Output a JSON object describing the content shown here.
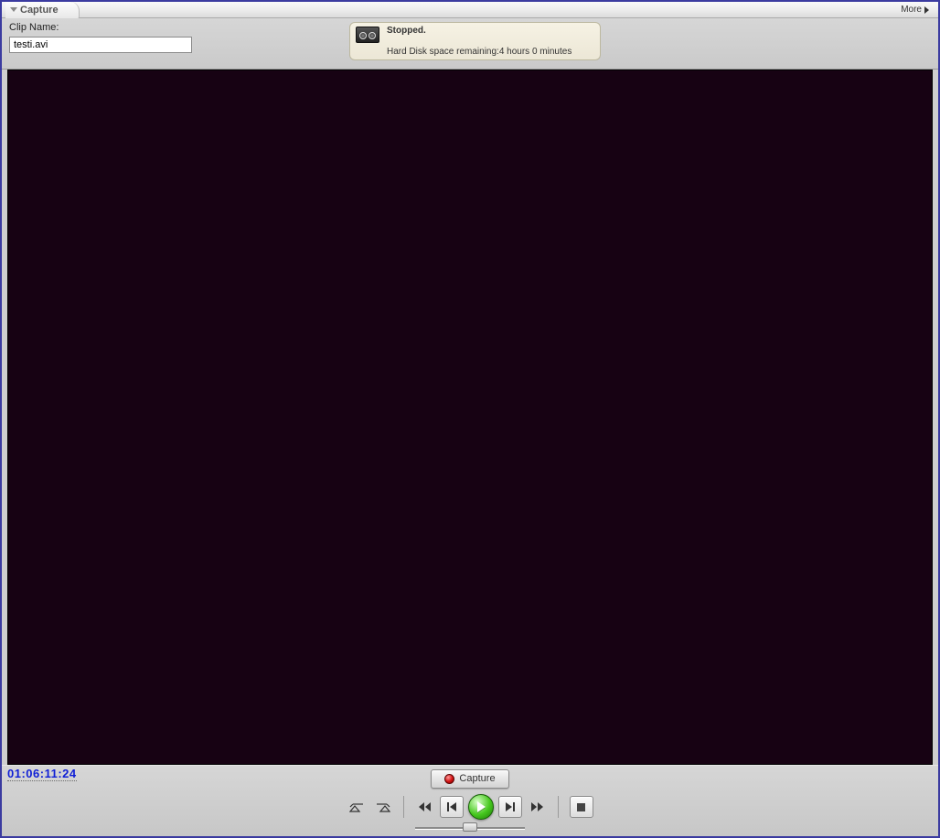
{
  "window": {
    "title": "Capture",
    "more_label": "More"
  },
  "header": {
    "clipname_label": "Clip Name:",
    "clipname_value": "testi.avi"
  },
  "status": {
    "title": "Stopped.",
    "subtitle": "Hard Disk space remaining:4 hours 0 minutes"
  },
  "timecode": "01:06:11:24",
  "transport": {
    "capture_label": "Capture"
  }
}
